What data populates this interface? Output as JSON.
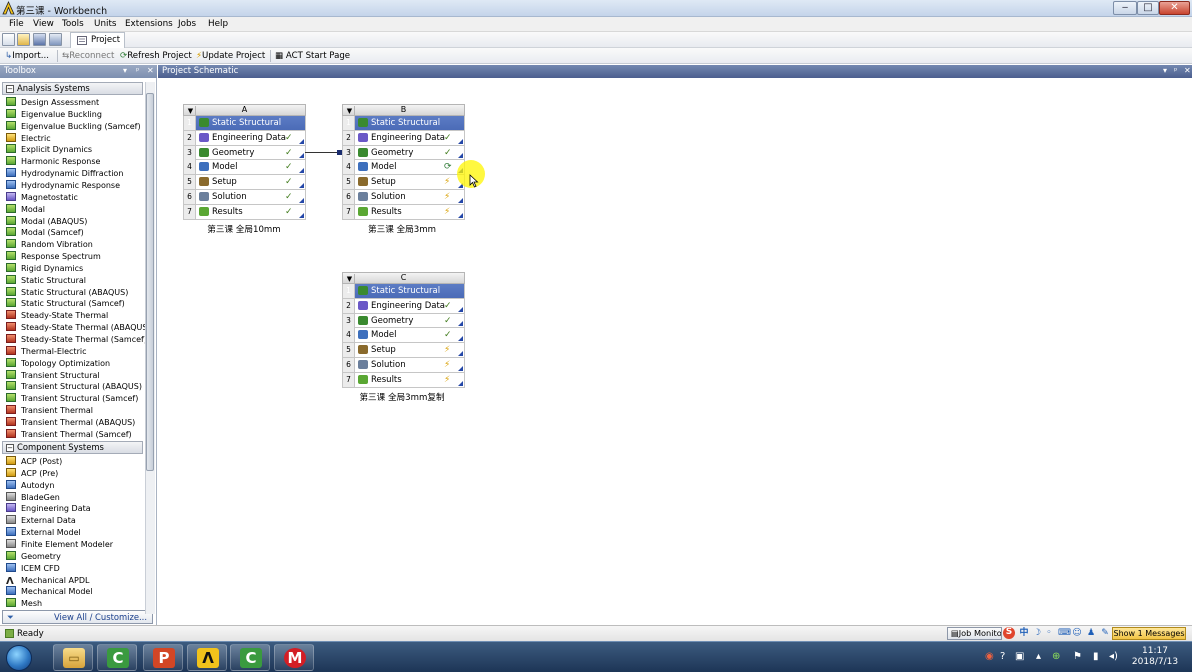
{
  "window": {
    "title": "第三课 - Workbench",
    "min": "‒",
    "max": "□",
    "close": "✕"
  },
  "menu": [
    "File",
    "View",
    "Tools",
    "Units",
    "Extensions",
    "Jobs",
    "Help"
  ],
  "toolbar1": {
    "tab": "Project"
  },
  "toolbar2": {
    "import": "Import...",
    "reconnect": "Reconnect",
    "refresh": "Refresh Project",
    "update": "Update Project",
    "act": "ACT Start Page"
  },
  "toolbox": {
    "title": "Toolbox",
    "controls": [
      "▾",
      "ᵖ",
      "✕"
    ],
    "group_analysis": "Analysis Systems",
    "analysis": [
      "Design Assessment",
      "Eigenvalue Buckling",
      "Eigenvalue Buckling (Samcef)",
      "Electric",
      "Explicit Dynamics",
      "Harmonic Response",
      "Hydrodynamic Diffraction",
      "Hydrodynamic Response",
      "Magnetostatic",
      "Modal",
      "Modal (ABAQUS)",
      "Modal (Samcef)",
      "Random Vibration",
      "Response Spectrum",
      "Rigid Dynamics",
      "Static Structural",
      "Static Structural (ABAQUS)",
      "Static Structural (Samcef)",
      "Steady-State Thermal",
      "Steady-State Thermal (ABAQUS)",
      "Steady-State Thermal (Samcef)",
      "Thermal-Electric",
      "Topology Optimization",
      "Transient Structural",
      "Transient Structural (ABAQUS)",
      "Transient Structural (Samcef)",
      "Transient Thermal",
      "Transient Thermal (ABAQUS)",
      "Transient Thermal (Samcef)"
    ],
    "analysis_icons": [
      "green",
      "green",
      "green",
      "electric",
      "green",
      "green",
      "blue",
      "blue",
      "purple",
      "green",
      "green",
      "green",
      "green",
      "green",
      "green",
      "green",
      "green",
      "green",
      "thermal",
      "thermal",
      "thermal",
      "thermal",
      "green",
      "green",
      "green",
      "green",
      "thermal",
      "thermal",
      "thermal"
    ],
    "group_component": "Component Systems",
    "component": [
      "ACP (Post)",
      "ACP (Pre)",
      "Autodyn",
      "BladeGen",
      "Engineering Data",
      "External Data",
      "External Model",
      "Finite Element Modeler",
      "Geometry",
      "ICEM CFD",
      "Mechanical APDL",
      "Mechanical Model",
      "Mesh"
    ],
    "component_icons": [
      "electric",
      "electric",
      "blue",
      "grey",
      "purple",
      "grey",
      "blue",
      "grey",
      "green",
      "blue",
      "ansys",
      "blue",
      "green"
    ],
    "view_all": "View All / Customize..."
  },
  "schematic": {
    "title": "Project Schematic",
    "controls": [
      "▾",
      "ᵖ",
      "✕"
    ],
    "systems": [
      {
        "letter": "A",
        "caption": "第三课 全局10mm",
        "rows": [
          "Static Structural",
          "Engineering Data",
          "Geometry",
          "Model",
          "Setup",
          "Solution",
          "Results"
        ],
        "status": [
          "",
          "✓",
          "✓",
          "✓",
          "✓",
          "✓",
          "✓"
        ]
      },
      {
        "letter": "B",
        "caption": "第三课 全局3mm",
        "rows": [
          "Static Structural",
          "Engineering Data",
          "Geometry",
          "Model",
          "Setup",
          "Solution",
          "Results"
        ],
        "status": [
          "",
          "✓",
          "✓",
          "⟳",
          "⚡",
          "⚡",
          "⚡"
        ]
      },
      {
        "letter": "C",
        "caption": "第三课 全局3mm复制",
        "rows": [
          "Static Structural",
          "Engineering Data",
          "Geometry",
          "Model",
          "Setup",
          "Solution",
          "Results"
        ],
        "status": [
          "",
          "✓",
          "✓",
          "✓",
          "⚡",
          "⚡",
          "⚡"
        ]
      }
    ],
    "row_icon_colors": [
      "#3a8a2f",
      "#6a58c7",
      "#3a8a2f",
      "#3d6fbd",
      "#8a6a2c",
      "#6b7f9c",
      "#5aa733"
    ]
  },
  "status": {
    "text": "Ready",
    "job_monitor": "Job Monitor...",
    "show_messages": "Show 1 Messages"
  },
  "taskbar": {
    "time": "11:17",
    "date": "2018/7/13"
  }
}
